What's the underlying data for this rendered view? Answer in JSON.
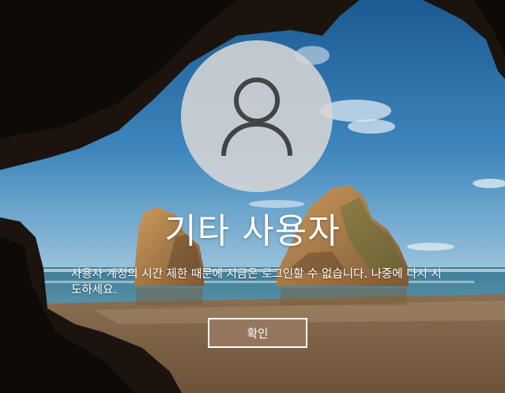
{
  "account": {
    "display_name": "기타 사용자",
    "avatar_icon": "user-silhouette-icon"
  },
  "notice": {
    "message": "사용자 계정의 시간 제한 때문에 지금은 로그인할 수 없습니다. 나중에 다시 시도하세요."
  },
  "actions": {
    "ok_label": "확인"
  },
  "colors": {
    "avatar_circle": "#d6d6d6",
    "avatar_glyph": "#444444",
    "button_fill": "#967860",
    "text": "#ffffff"
  }
}
